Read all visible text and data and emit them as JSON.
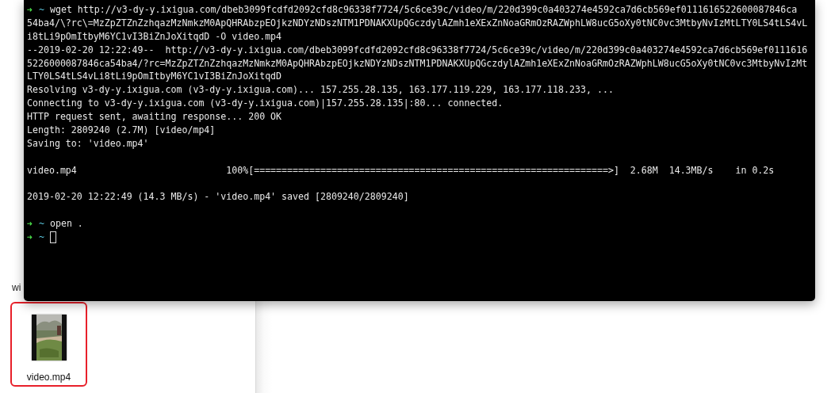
{
  "finder": {
    "sidebar_text": "wi",
    "files": [
      {
        "name": "video.mp4",
        "selected": true,
        "kind": "picture"
      }
    ]
  },
  "terminal": {
    "lines": [
      {
        "kind": "prompt",
        "arrow": "➜",
        "dir": "~",
        "command": "wget http://v3-dy-y.ixigua.com/dbeb3099fcdfd2092cfd8c96338f7724/5c6ce39c/video/m/220d399c0a403274e4592ca7d6cb569ef0111616522600087846ca"
      },
      {
        "kind": "output",
        "text": "54ba4/\\?rc\\=MzZpZTZnZzhqazMzNmkzM0ApQHRAbzpEOjkzNDYzNDszNTM1PDNAKXUpQGczdylAZmh1eXExZnNoaGRmOzRAZWphLW8ucG5oXy0tNC0vc3MtbyNvIzMtLTY0LS4tLS4vL"
      },
      {
        "kind": "output",
        "text": "i8tLi9pOmItbyM6YC1vI3BiZnJoXitqdD -O video.mp4"
      },
      {
        "kind": "output",
        "text": "--2019-02-20 12:22:49--  http://v3-dy-y.ixigua.com/dbeb3099fcdfd2092cfd8c96338f7724/5c6ce39c/video/m/220d399c0a403274e4592ca7d6cb569ef0111616"
      },
      {
        "kind": "output",
        "text": "5226000087846ca54ba4/?rc=MzZpZTZnZzhqazMzNmkzM0ApQHRAbzpEOjkzNDYzNDszNTM1PDNAKXUpQGczdylAZmh1eXExZnNoaGRmOzRAZWphLW8ucG5oXy0tNC0vc3MtbyNvIzMt"
      },
      {
        "kind": "output",
        "text": "LTY0LS4tLS4vLi8tLi9pOmItbyM6YC1vI3BiZnJoXitqdD"
      },
      {
        "kind": "output",
        "text": "Resolving v3-dy-y.ixigua.com (v3-dy-y.ixigua.com)... 157.255.28.135, 163.177.119.229, 163.177.118.233, ..."
      },
      {
        "kind": "output",
        "text": "Connecting to v3-dy-y.ixigua.com (v3-dy-y.ixigua.com)|157.255.28.135|:80... connected."
      },
      {
        "kind": "output",
        "text": "HTTP request sent, awaiting response... 200 OK"
      },
      {
        "kind": "output",
        "text": "Length: 2809240 (2.7M) [video/mp4]"
      },
      {
        "kind": "output",
        "text": "Saving to: 'video.mp4'"
      },
      {
        "kind": "blank"
      },
      {
        "kind": "output",
        "text": "video.mp4                           100%[================================================================>]  2.68M  14.3MB/s    in 0.2s"
      },
      {
        "kind": "blank"
      },
      {
        "kind": "output",
        "text": "2019-02-20 12:22:49 (14.3 MB/s) - 'video.mp4' saved [2809240/2809240]"
      },
      {
        "kind": "blank"
      },
      {
        "kind": "prompt",
        "arrow": "➜",
        "dir": "~",
        "command": "open ."
      },
      {
        "kind": "prompt",
        "arrow": "➜",
        "dir": "~",
        "cursor": true
      }
    ]
  }
}
